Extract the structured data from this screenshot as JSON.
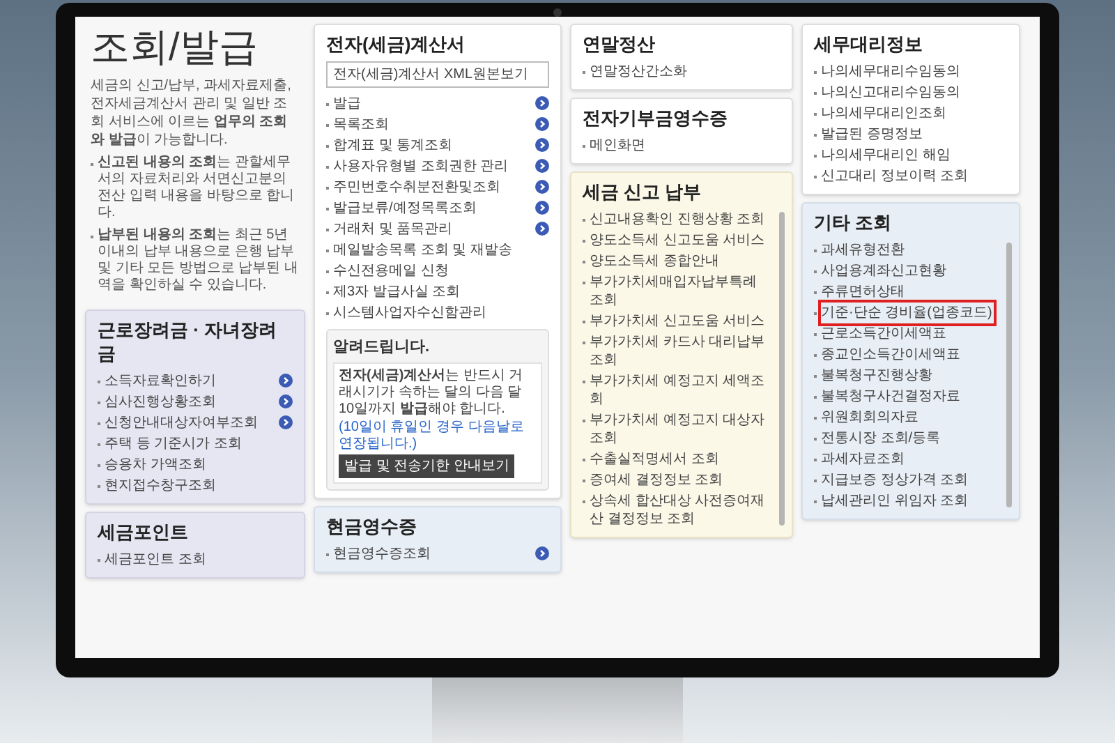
{
  "header": {
    "title": "조회/발급",
    "intro": "세금의 신고/납부, 과세자료제출, 전자세금계산서 관리 및 일반 조회 서비스에 이르는 **업무의 조회와 발급**이 가능합니다.",
    "notes": [
      "**신고된 내용의 조회**는 관할세무서의 자료처리와 서면신고분의 전산 입력 내용을 바탕으로 합니다.",
      "**납부된 내용의 조회**는 최근 5년 이내의 납부 내용으로 은행 납부 및 기타 모든 방법으로 납부된 내역을 확인하실 수 있습니다."
    ]
  },
  "columns": [
    {
      "cards": [
        {
          "title": "근로장려금 · 자녀장려금",
          "kind": "purple",
          "scrollbar": false,
          "items": [
            {
              "label": "소득자료확인하기",
              "arrow": true
            },
            {
              "label": "심사진행상황조회",
              "arrow": true
            },
            {
              "label": "신청안내대상자여부조회",
              "arrow": true
            },
            {
              "label": "주택 등 기준시가 조회",
              "arrow": false
            },
            {
              "label": "승용차 가액조회",
              "arrow": false
            },
            {
              "label": "현지접수창구조회",
              "arrow": false
            }
          ]
        },
        {
          "title": "세금포인트",
          "kind": "purple",
          "scrollbar": false,
          "items": [
            {
              "label": "세금포인트 조회",
              "arrow": false
            }
          ]
        }
      ]
    },
    {
      "cards": [
        {
          "title": "전자(세금)계산서",
          "kind": "white",
          "scrollbar": false,
          "button": "전자(세금)계산서 XML원본보기",
          "items": [
            {
              "label": "발급",
              "arrow": true
            },
            {
              "label": "목록조회",
              "arrow": true
            },
            {
              "label": "합계표 및 통계조회",
              "arrow": true
            },
            {
              "label": "사용자유형별 조회권한 관리",
              "arrow": true
            },
            {
              "label": "주민번호수취분전환및조회",
              "arrow": true
            },
            {
              "label": "발급보류/예정목록조회",
              "arrow": true
            },
            {
              "label": "거래처 및 품목관리",
              "arrow": true
            },
            {
              "label": "메일발송목록 조회 및 재발송",
              "arrow": false
            },
            {
              "label": "수신전용메일 신청",
              "arrow": false
            },
            {
              "label": "제3자 발급사실 조회",
              "arrow": false
            },
            {
              "label": "시스템사업자수신함관리",
              "arrow": false
            }
          ],
          "notice": {
            "title": "알려드립니다.",
            "text": "**전자(세금)계산서**는 반드시 거래시기가 속하는 달의 다음 달 10일까지 **발급**해야 합니다.",
            "small": "(10일이 휴일인 경우 다음날로 연장됩니다.)",
            "button": "발급 및 전송기한 안내보기"
          }
        },
        {
          "title": "현금영수증",
          "kind": "blue",
          "scrollbar": false,
          "items": [
            {
              "label": "현금영수증조회",
              "arrow": true
            }
          ]
        }
      ]
    },
    {
      "cards": [
        {
          "title": "연말정산",
          "kind": "white",
          "scrollbar": false,
          "items": [
            {
              "label": "연말정산간소화",
              "arrow": false
            }
          ]
        },
        {
          "title": "전자기부금영수증",
          "kind": "white",
          "scrollbar": false,
          "items": [
            {
              "label": "메인화면",
              "arrow": false
            }
          ]
        },
        {
          "title": "세금 신고 납부",
          "kind": "cream",
          "scrollbar": true,
          "items": [
            {
              "label": "신고내용확인 진행상황 조회",
              "arrow": false
            },
            {
              "label": "양도소득세 신고도움 서비스",
              "arrow": false
            },
            {
              "label": "양도소득세 종합안내",
              "arrow": false
            },
            {
              "label": "부가가치세매입자납부특례조회",
              "arrow": false
            },
            {
              "label": "부가가치세 신고도움 서비스",
              "arrow": false
            },
            {
              "label": "부가가치세 카드사 대리납부 조회",
              "arrow": false
            },
            {
              "label": "부가가치세 예정고지 세액조회",
              "arrow": false
            },
            {
              "label": "부가가치세 예정고지 대상자 조회",
              "arrow": false
            },
            {
              "label": "수출실적명세서 조회",
              "arrow": false
            },
            {
              "label": "증여세 결정정보 조회",
              "arrow": false
            },
            {
              "label": "상속세 합산대상 사전증여재산 결정정보 조회",
              "arrow": false
            }
          ]
        }
      ]
    },
    {
      "cards": [
        {
          "title": "세무대리정보",
          "kind": "white",
          "scrollbar": false,
          "items": [
            {
              "label": "나의세무대리수임동의",
              "arrow": false
            },
            {
              "label": "나의신고대리수임동의",
              "arrow": false
            },
            {
              "label": "나의세무대리인조회",
              "arrow": false
            },
            {
              "label": "발급된 증명정보",
              "arrow": false
            },
            {
              "label": "나의세무대리인 해임",
              "arrow": false
            },
            {
              "label": "신고대리 정보이력 조회",
              "arrow": false
            }
          ]
        },
        {
          "title": "기타 조회",
          "kind": "blue",
          "scrollbar": true,
          "items": [
            {
              "label": "과세유형전환",
              "arrow": false,
              "highlighted": false
            },
            {
              "label": "사업용계좌신고현황",
              "arrow": false,
              "highlighted": false
            },
            {
              "label": "주류면허상태",
              "arrow": false,
              "highlighted": false
            },
            {
              "label": "기준·단순 경비율(업종코드)",
              "arrow": false,
              "highlighted": true
            },
            {
              "label": "근로소득간이세액표",
              "arrow": false,
              "highlighted": false
            },
            {
              "label": "종교인소득간이세액표",
              "arrow": false,
              "highlighted": false
            },
            {
              "label": "불복청구진행상황",
              "arrow": false,
              "highlighted": false
            },
            {
              "label": "불복청구사건결정자료",
              "arrow": false,
              "highlighted": false
            },
            {
              "label": "위원회회의자료",
              "arrow": false,
              "highlighted": false
            },
            {
              "label": "전통시장 조회/등록",
              "arrow": false,
              "highlighted": false
            },
            {
              "label": "과세자료조회",
              "arrow": false,
              "highlighted": false
            },
            {
              "label": "지급보증 정상가격 조회",
              "arrow": false,
              "highlighted": false
            },
            {
              "label": "납세관리인 위임자 조회",
              "arrow": false,
              "highlighted": false
            }
          ]
        }
      ]
    }
  ]
}
